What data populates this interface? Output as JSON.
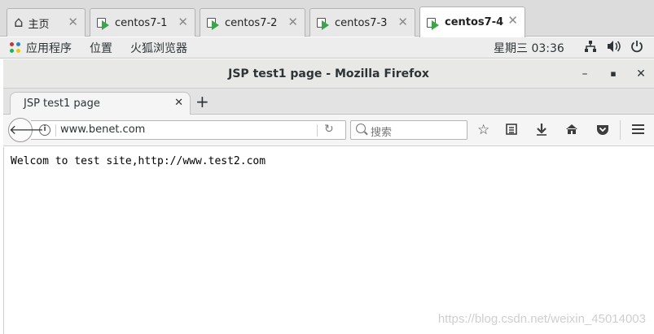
{
  "vmware": {
    "tabs": [
      {
        "label": "主页",
        "icon": "home-icon",
        "active": false
      },
      {
        "label": "centos7-1",
        "icon": "vm-icon",
        "active": false
      },
      {
        "label": "centos7-2",
        "icon": "vm-icon",
        "active": false
      },
      {
        "label": "centos7-3",
        "icon": "vm-icon",
        "active": false
      },
      {
        "label": "centos7-4",
        "icon": "vm-icon",
        "active": true
      }
    ],
    "close_glyph": "✕"
  },
  "gnome": {
    "applications": "应用程序",
    "places": "位置",
    "firefox_menu": "火狐浏览器",
    "clock": "星期三 03:36",
    "tray_icons": [
      "network-icon",
      "volume-icon",
      "power-icon"
    ]
  },
  "firefox": {
    "window_title": "JSP test1 page - Mozilla Firefox",
    "tab_title": "JSP test1 page",
    "url": "www.benet.com",
    "search_placeholder": "搜索",
    "toolbar_icons": [
      "bookmark-star-icon",
      "reading-list-icon",
      "download-icon",
      "home-icon",
      "pocket-icon",
      "menu-icon"
    ]
  },
  "page": {
    "body_text": "Welcom to test site,http://www.test2.com"
  },
  "watermark": "https://blog.csdn.net/weixin_45014003",
  "colors": {
    "vm_play": "#3aa64a",
    "gnome_bar": "#ededed",
    "firefox_chrome": "#e8e8e7"
  }
}
